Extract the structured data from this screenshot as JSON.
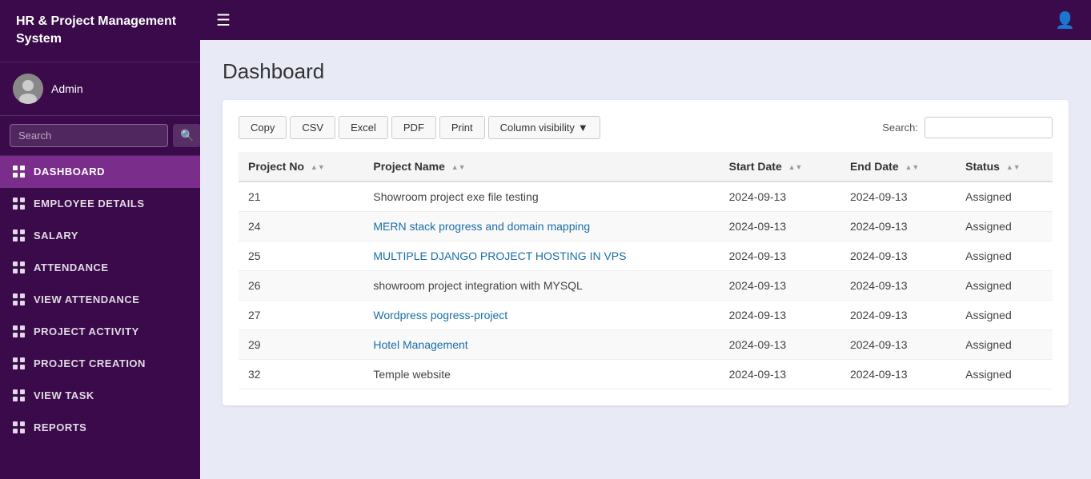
{
  "app": {
    "title": "HR & Project Management System"
  },
  "topbar": {
    "hamburger_icon": "☰",
    "user_icon": "👤"
  },
  "sidebar": {
    "user_name": "Admin",
    "search_placeholder": "Search",
    "nav_items": [
      {
        "id": "dashboard",
        "label": "DASHBOARD",
        "active": true
      },
      {
        "id": "employee-details",
        "label": "EMPLOYEE DETAILS",
        "active": false
      },
      {
        "id": "salary",
        "label": "SALARY",
        "active": false
      },
      {
        "id": "attendance",
        "label": "ATTENDANCE",
        "active": false
      },
      {
        "id": "view-attendance",
        "label": "VIEW ATTENDANCE",
        "active": false
      },
      {
        "id": "project-activity",
        "label": "PROJECT ACTIVITY",
        "active": false
      },
      {
        "id": "project-creation",
        "label": "PROJECT CREATION",
        "active": false
      },
      {
        "id": "view-task",
        "label": "VIEW TASK",
        "active": false
      },
      {
        "id": "reports",
        "label": "REPORTS",
        "active": false
      }
    ]
  },
  "main": {
    "page_title": "Dashboard",
    "toolbar": {
      "buttons": [
        "Copy",
        "CSV",
        "Excel",
        "PDF",
        "Print"
      ],
      "column_visibility_label": "Column visibility",
      "search_label": "Search:"
    },
    "table": {
      "columns": [
        {
          "key": "project_no",
          "label": "Project No"
        },
        {
          "key": "project_name",
          "label": "Project Name"
        },
        {
          "key": "start_date",
          "label": "Start Date"
        },
        {
          "key": "end_date",
          "label": "End Date"
        },
        {
          "key": "status",
          "label": "Status"
        }
      ],
      "rows": [
        {
          "project_no": "21",
          "project_name": "Showroom project exe file testing",
          "start_date": "2024-09-13",
          "end_date": "2024-09-13",
          "status": "Assigned",
          "name_is_link": false
        },
        {
          "project_no": "24",
          "project_name": "MERN stack progress and domain mapping",
          "start_date": "2024-09-13",
          "end_date": "2024-09-13",
          "status": "Assigned",
          "name_is_link": true
        },
        {
          "project_no": "25",
          "project_name": "MULTIPLE DJANGO PROJECT HOSTING IN VPS",
          "start_date": "2024-09-13",
          "end_date": "2024-09-13",
          "status": "Assigned",
          "name_is_link": true
        },
        {
          "project_no": "26",
          "project_name": "showroom project integration with MYSQL",
          "start_date": "2024-09-13",
          "end_date": "2024-09-13",
          "status": "Assigned",
          "name_is_link": false
        },
        {
          "project_no": "27",
          "project_name": "Wordpress pogress-project",
          "start_date": "2024-09-13",
          "end_date": "2024-09-13",
          "status": "Assigned",
          "name_is_link": true
        },
        {
          "project_no": "29",
          "project_name": "Hotel Management",
          "start_date": "2024-09-13",
          "end_date": "2024-09-13",
          "status": "Assigned",
          "name_is_link": true
        },
        {
          "project_no": "32",
          "project_name": "Temple website",
          "start_date": "2024-09-13",
          "end_date": "2024-09-13",
          "status": "Assigned",
          "name_is_link": false
        }
      ]
    }
  }
}
